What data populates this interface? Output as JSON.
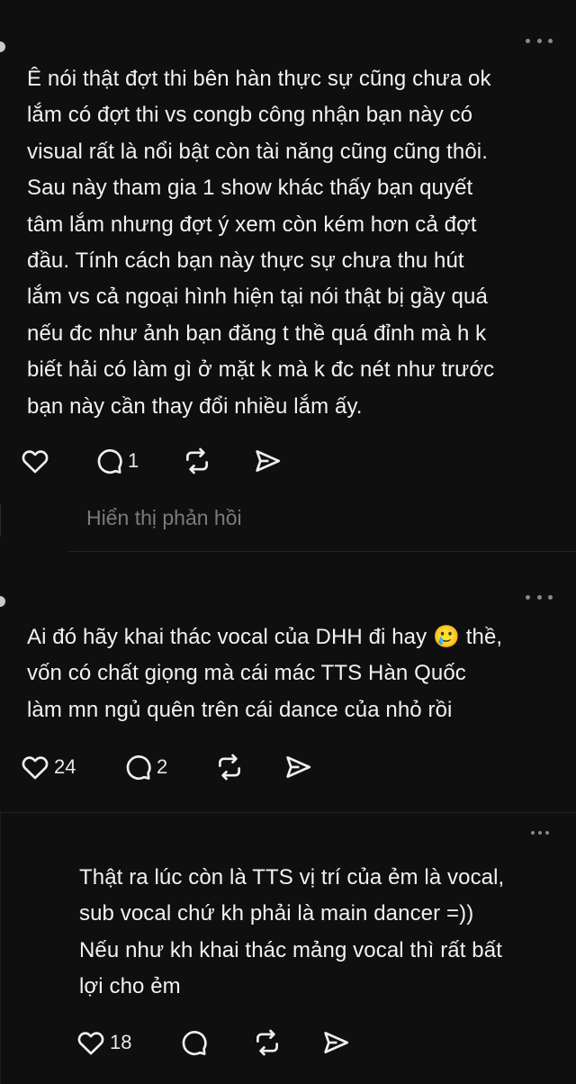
{
  "posts": [
    {
      "text": "Ê nói thật đợt thi bên hàn thực sự cũng chưa ok\nlắm có đợt thi vs congb công nhận bạn này có\nvisual rất là nổi bật còn tài năng cũng cũng thôi.\nSau này tham gia 1 show khác thấy bạn quyết\ntâm lắm nhưng đợt ý xem còn kém hơn cả đợt\nđầu. Tính cách bạn này thực sự chưa thu hút\nlắm vs cả ngoại hình hiện tại nói thật bị gầy quá\nnếu đc như ảnh bạn đăng t thề quá đỉnh mà h k\nbiết hải có làm gì ở mặt k mà k đc nét như trước\nbạn này cần thay đổi nhiều lắm ấy.",
      "likes": "",
      "replies": "1",
      "show_replies": "Hiển thị phản hồi",
      "icons": [
        "heart-icon",
        "comment-icon",
        "repost-icon",
        "share-icon",
        "more-icon"
      ]
    },
    {
      "text": "Ai đó hãy khai thác vocal của DHH đi hay 🥲 thề,\nvốn có chất giọng mà cái mác TTS Hàn Quốc\nlàm mn ngủ quên trên cái dance của nhỏ rồi",
      "likes": "24",
      "replies": "2",
      "icons": [
        "heart-icon",
        "comment-icon",
        "repost-icon",
        "share-icon",
        "more-icon"
      ]
    },
    {
      "text": "Thật ra lúc còn là TTS vị trí của ẻm là vocal,\nsub vocal chứ kh phải là main dancer =))\nNếu như kh khai thác mảng vocal thì rất bất\nlợi cho ẻm",
      "likes": "18",
      "replies": "",
      "icons": [
        "heart-icon",
        "comment-icon",
        "repost-icon",
        "share-icon",
        "more-icon"
      ]
    }
  ],
  "colors": {
    "background": "#0f0f0f",
    "text": "#f2f2f2",
    "muted": "#7b7b7b",
    "icon": "#eeeeee"
  }
}
